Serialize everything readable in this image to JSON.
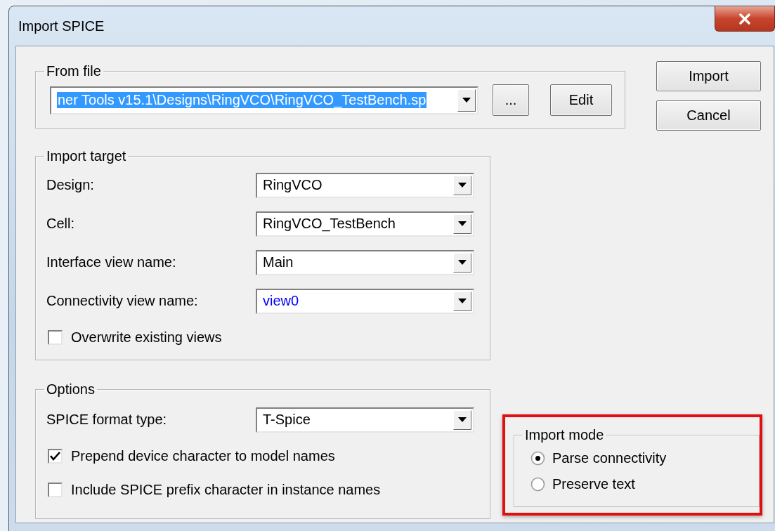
{
  "window": {
    "title": "Import SPICE"
  },
  "from_file": {
    "label": "From file",
    "path": "ner Tools v15.1\\Designs\\RingVCO\\RingVCO_TestBench.sp",
    "text_selected": true,
    "browse_button": "...",
    "edit_button": "Edit"
  },
  "buttons": [
    "Import",
    "Cancel"
  ],
  "import_target": {
    "label": "Import target",
    "fields": [
      {
        "label": "Design:",
        "value": "RingVCO",
        "color": "#000000"
      },
      {
        "label": "Cell:",
        "value": "RingVCO_TestBench",
        "color": "#000000"
      },
      {
        "label": "Interface view name:",
        "value": "Main",
        "color": "#000000"
      },
      {
        "label": "Connectivity view name:",
        "value": "view0",
        "color": "#0000ff"
      }
    ],
    "checkboxes": [
      {
        "label": "Overwrite existing views",
        "checked": false
      }
    ]
  },
  "options": {
    "label": "Options",
    "fields": [
      {
        "label": "SPICE format type:",
        "value": "T-Spice",
        "color": "#000000"
      }
    ],
    "checkboxes": [
      {
        "label": "Prepend device character to model names",
        "checked": true
      },
      {
        "label": "Include SPICE prefix character in instance names",
        "checked": false
      }
    ]
  },
  "import_mode": {
    "label": "Import mode",
    "options": [
      {
        "label": "Parse connectivity",
        "selected": true
      },
      {
        "label": "Preserve text",
        "selected": false
      }
    ]
  }
}
